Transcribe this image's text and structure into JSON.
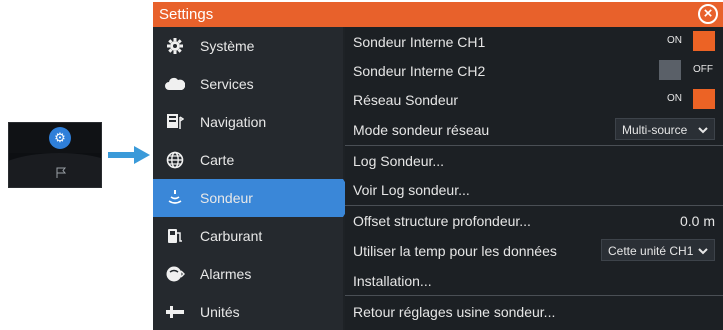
{
  "colors": {
    "accent": "#e8612b",
    "selection": "#3a87d8",
    "toggle_on": "#ec6325",
    "toggle_off": "#5a6068"
  },
  "window": {
    "title": "Settings",
    "close_icon": "close-circle-icon"
  },
  "sidebar": {
    "items": [
      {
        "label": "Système",
        "icon": "gear-icon"
      },
      {
        "label": "Services",
        "icon": "cloud-icon"
      },
      {
        "label": "Navigation",
        "icon": "navigation-icon"
      },
      {
        "label": "Carte",
        "icon": "globe-icon"
      },
      {
        "label": "Sondeur",
        "icon": "sonar-icon",
        "selected": true
      },
      {
        "label": "Carburant",
        "icon": "fuel-icon"
      },
      {
        "label": "Alarmes",
        "icon": "alarm-icon"
      },
      {
        "label": "Unités",
        "icon": "units-icon"
      }
    ]
  },
  "panel": {
    "rows": [
      {
        "label": "Sondeur Interne CH1",
        "toggle": "ON"
      },
      {
        "label": "Sondeur Interne CH2",
        "toggle": "OFF"
      },
      {
        "label": "Réseau Sondeur",
        "toggle": "ON"
      },
      {
        "label": "Mode sondeur réseau",
        "dropdown": "Multi-source"
      },
      {
        "label": "Log Sondeur..."
      },
      {
        "label": "Voir Log sondeur..."
      },
      {
        "label": "Offset structure profondeur...",
        "value": "0.0 m"
      },
      {
        "label": "Utiliser la temp pour les données",
        "dropdown": "Cette unité CH1"
      },
      {
        "label": "Installation..."
      },
      {
        "label": "Retour réglages usine sondeur..."
      }
    ]
  }
}
